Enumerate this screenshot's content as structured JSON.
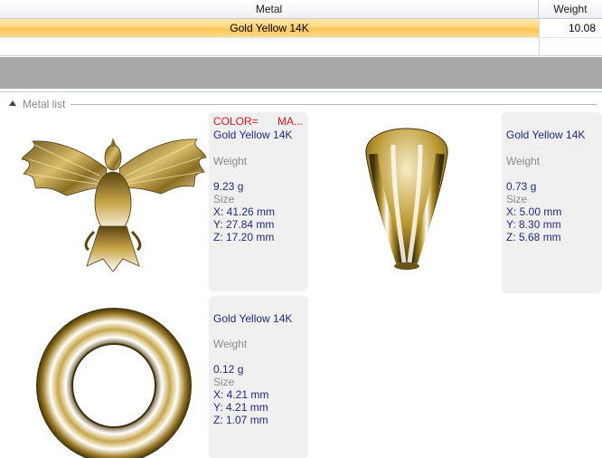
{
  "grid": {
    "headers": {
      "metal": "Metal",
      "weight": "Weight"
    },
    "selected_row": {
      "metal": "Gold Yellow 14K",
      "weight": "10.08"
    }
  },
  "metal_list": {
    "title": "Metal list",
    "items": [
      {
        "color_label": "COLOR=",
        "material_label": "MA...",
        "metal": "Gold Yellow 14K",
        "weight_label": "Weight",
        "weight": "9.23 g",
        "size_label": "Size",
        "x": "X: 41.26 mm",
        "y": "Y: 27.84 mm",
        "z": "Z: 17.20 mm",
        "thumbnail_icon": "eagle-pendant-icon"
      },
      {
        "metal": "Gold Yellow 14K",
        "weight_label": "Weight",
        "weight": "0.73 g",
        "size_label": "Size",
        "x": "X: 5.00 mm",
        "y": "Y: 8.30 mm",
        "z": "Z: 5.68 mm",
        "thumbnail_icon": "bail-icon"
      },
      {
        "metal": "Gold Yellow 14K",
        "weight_label": "Weight",
        "weight": "0.12 g",
        "size_label": "Size",
        "x": "X: 4.21 mm",
        "y": "Y: 4.21 mm",
        "z": "Z: 1.07 mm",
        "thumbnail_icon": "jump-ring-icon"
      }
    ]
  },
  "colors": {
    "selection": "#fbc459",
    "gold": "#b8962e",
    "text_blue": "#1f2a80",
    "text_red": "#e0141e"
  }
}
